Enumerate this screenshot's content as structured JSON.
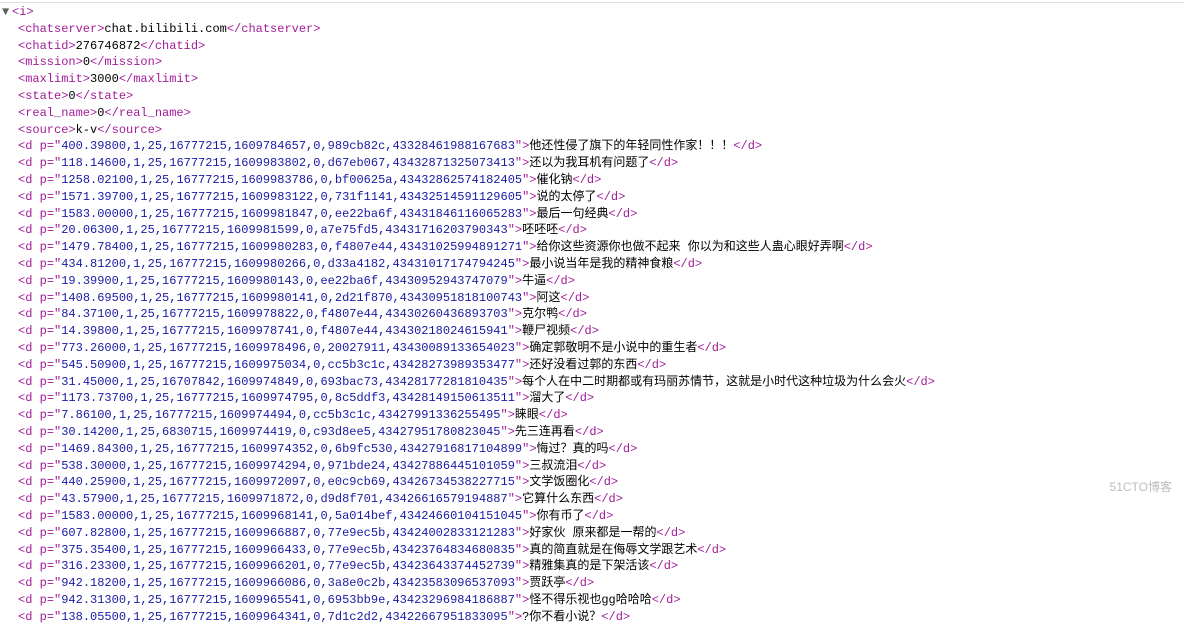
{
  "root_tag": "i",
  "header": {
    "chatserver": "chat.bilibili.com",
    "chatid": "276746872",
    "mission": "0",
    "maxlimit": "3000",
    "state": "0",
    "real_name": "0",
    "source": "k-v"
  },
  "danmaku": [
    {
      "p": "400.39800,1,25,16777215,1609784657,0,989cb82c,43328461988167683",
      "text": "他还性侵了旗下的年轻同性作家！！！"
    },
    {
      "p": "118.14600,1,25,16777215,1609983802,0,d67eb067,43432871325073413",
      "text": "还以为我耳机有问题了"
    },
    {
      "p": "1258.02100,1,25,16777215,1609983786,0,bf00625a,43432862574182405",
      "text": "催化钠"
    },
    {
      "p": "1571.39700,1,25,16777215,1609983122,0,731f1141,43432514591129605",
      "text": "说的太停了"
    },
    {
      "p": "1583.00000,1,25,16777215,1609981847,0,ee22ba6f,43431846116065283",
      "text": "最后一句经典"
    },
    {
      "p": "20.06300,1,25,16777215,1609981599,0,a7e75fd5,43431716203790343",
      "text": "呸呸呸"
    },
    {
      "p": "1479.78400,1,25,16777215,1609980283,0,f4807e44,43431025994891271",
      "text": "给你这些资源你也做不起来 你以为和这些人蛊心眼好弄啊"
    },
    {
      "p": "434.81200,1,25,16777215,1609980266,0,d33a4182,43431017174794245",
      "text": "最小说当年是我的精神食粮"
    },
    {
      "p": "19.39900,1,25,16777215,1609980143,0,ee22ba6f,43430952943747079",
      "text": "牛逼"
    },
    {
      "p": "1408.69500,1,25,16777215,1609980141,0,2d21f870,43430951818100743",
      "text": "阿这"
    },
    {
      "p": "84.37100,1,25,16777215,1609978822,0,f4807e44,43430260436893703",
      "text": "克尔鸭"
    },
    {
      "p": "14.39800,1,25,16777215,1609978741,0,f4807e44,43430218024615941",
      "text": "鞭尸视频"
    },
    {
      "p": "773.26000,1,25,16777215,1609978496,0,20027911,43430089133654023",
      "text": "确定郭敬明不是小说中的重生者"
    },
    {
      "p": "545.50900,1,25,16777215,1609975034,0,cc5b3c1c,43428273989353477",
      "text": "还好没看过郭的东西"
    },
    {
      "p": "31.45000,1,25,16707842,1609974849,0,693bac73,43428177281810435",
      "text": "每个人在中二时期都或有玛丽苏情节，这就是小时代这种垃圾为什么会火"
    },
    {
      "p": "1173.73700,1,25,16777215,1609974795,0,8c5ddf3,43428149150613511",
      "text": "溜大了"
    },
    {
      "p": "7.86100,1,25,16777215,1609974494,0,cc5b3c1c,43427991336255495",
      "text": "睐眼"
    },
    {
      "p": "30.14200,1,25,6830715,1609974419,0,c93d8ee5,43427951780823045",
      "text": "先三连再看"
    },
    {
      "p": "1469.84300,1,25,16777215,1609974352,0,6b9fc530,43427916817104899",
      "text": "悔过？真的吗"
    },
    {
      "p": "538.30000,1,25,16777215,1609974294,0,971bde24,43427886445101059",
      "text": "三叔流泪"
    },
    {
      "p": "440.25900,1,25,16777215,1609972097,0,e0c9cb69,43426734538227715",
      "text": "文学饭圈化"
    },
    {
      "p": "43.57900,1,25,16777215,1609971872,0,d9d8f701,43426616579194887",
      "text": "它算什么东西"
    },
    {
      "p": "1583.00000,1,25,16777215,1609968141,0,5a014bef,43424660104151045",
      "text": "你有币了"
    },
    {
      "p": "607.82800,1,25,16777215,1609966887,0,77e9ec5b,43424002833121283",
      "text": "好家伙 原来都是一帮的"
    },
    {
      "p": "375.35400,1,25,16777215,1609966433,0,77e9ec5b,43423764834680835",
      "text": "真的简直就是在侮辱文学跟艺术"
    },
    {
      "p": "316.23300,1,25,16777215,1609966201,0,77e9ec5b,43423643374452739",
      "text": "精雅集真的是下架活该"
    },
    {
      "p": "942.18200,1,25,16777215,1609966086,0,3a8e0c2b,43423583096537093",
      "text": "贾跃亭"
    },
    {
      "p": "942.31300,1,25,16777215,1609965541,0,6953bb9e,43423296984186887",
      "text": "怪不得乐视也gg哈哈哈"
    },
    {
      "p": "138.05500,1,25,16777215,1609964341,0,7d1c2d2,43422667951833095",
      "text": "?你不看小说？"
    }
  ],
  "watermark": "51CTO博客",
  "toggle_glyph": "▼"
}
